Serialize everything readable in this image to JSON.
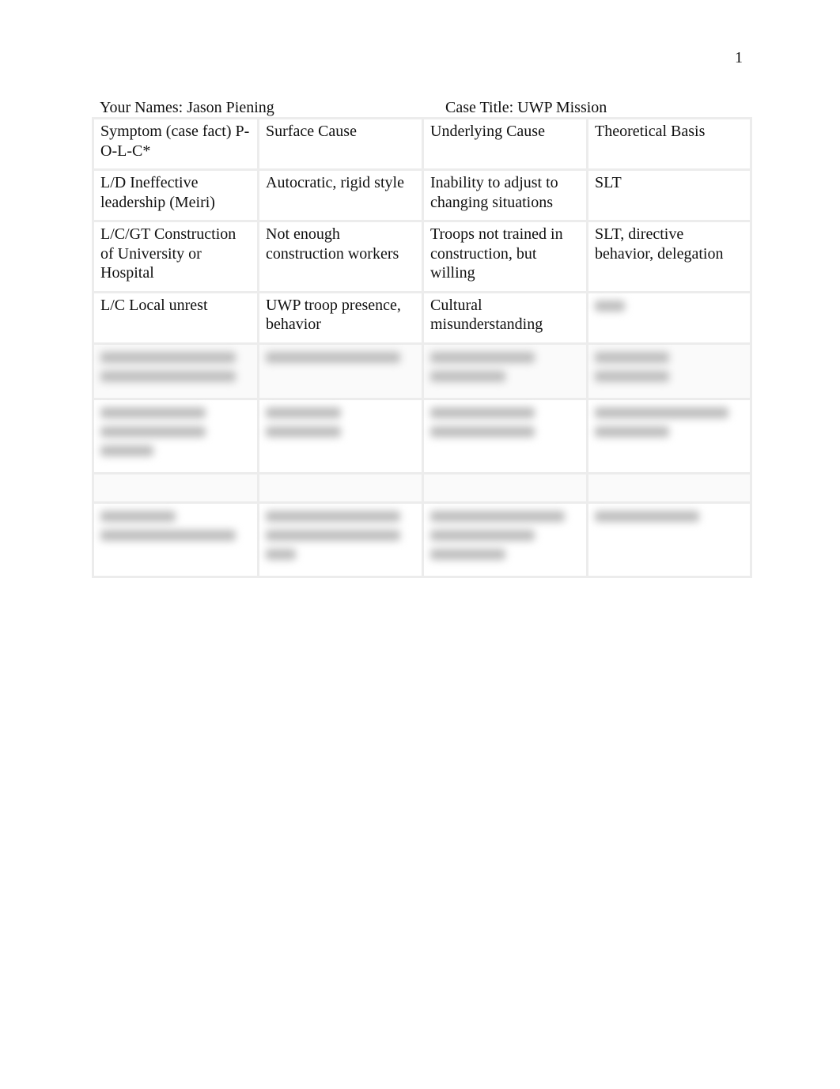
{
  "page": {
    "number": "1"
  },
  "header": {
    "names": "Your Names: Jason Piening",
    "case_title": "Case Title: UWP Mission"
  },
  "table": {
    "columns": [
      "Symptom (case fact) P-O-L-C*",
      "Surface Cause",
      "Underlying Cause",
      "Theoretical Basis"
    ],
    "rows": [
      [
        "L/D Ineffective leadership (Meiri)",
        "Autocratic, rigid style",
        "Inability to adjust to changing situations",
        "SLT"
      ],
      [
        "L/C/GT Construction of University or Hospital",
        "Not enough construction workers",
        "Troops not trained in construction, but willing",
        "SLT, directive behavior, delegation"
      ],
      [
        "L/C Local unrest",
        "UWP troop presence, behavior",
        "Cultural misunderstanding",
        ""
      ]
    ],
    "blurred_rows_note": "Remaining rows are blurred/obscured in the screenshot"
  }
}
